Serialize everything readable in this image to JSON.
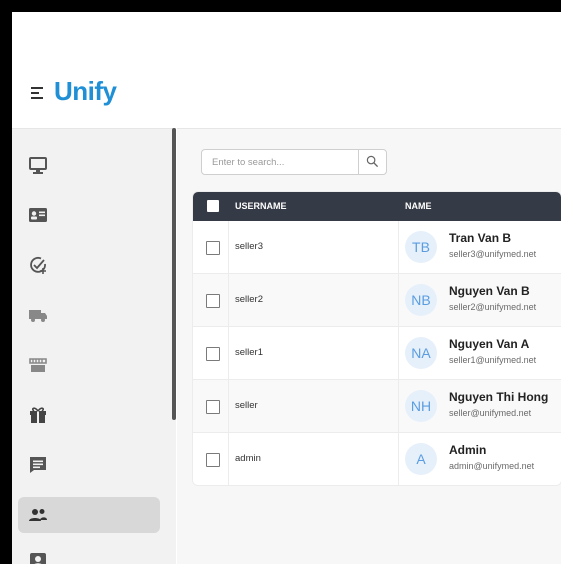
{
  "app": {
    "logo_text": "Unify",
    "brand_color": "#1f8fd6"
  },
  "sidebar": {
    "items": [
      {
        "icon": "monitor-icon",
        "active": false
      },
      {
        "icon": "id-card-icon",
        "active": false
      },
      {
        "icon": "check-plus-icon",
        "active": false
      },
      {
        "icon": "truck-icon",
        "active": false
      },
      {
        "icon": "store-icon",
        "active": false
      },
      {
        "icon": "gift-icon",
        "active": false
      },
      {
        "icon": "message-icon",
        "active": false
      },
      {
        "icon": "mail-icon",
        "active": false
      },
      {
        "icon": "users-icon",
        "active": true
      },
      {
        "icon": "contact-icon",
        "active": false
      }
    ]
  },
  "search": {
    "placeholder": "Enter to search...",
    "icon": "search-icon"
  },
  "table": {
    "columns": {
      "username": "USERNAME",
      "name": "NAME"
    },
    "header_color": "#343a46",
    "rows": [
      {
        "username": "seller3",
        "initials": "TB",
        "name": "Tran Van B",
        "email": "seller3@unifymed.net"
      },
      {
        "username": "seller2",
        "initials": "NB",
        "name": "Nguyen Van B",
        "email": "seller2@unifymed.net"
      },
      {
        "username": "seller1",
        "initials": "NA",
        "name": "Nguyen Van A",
        "email": "seller1@unifymed.net"
      },
      {
        "username": "seller",
        "initials": "NH",
        "name": "Nguyen Thi Hong",
        "email": "seller@unifymed.net"
      },
      {
        "username": "admin",
        "initials": "A",
        "name": "Admin",
        "email": "admin@unifymed.net"
      }
    ]
  }
}
